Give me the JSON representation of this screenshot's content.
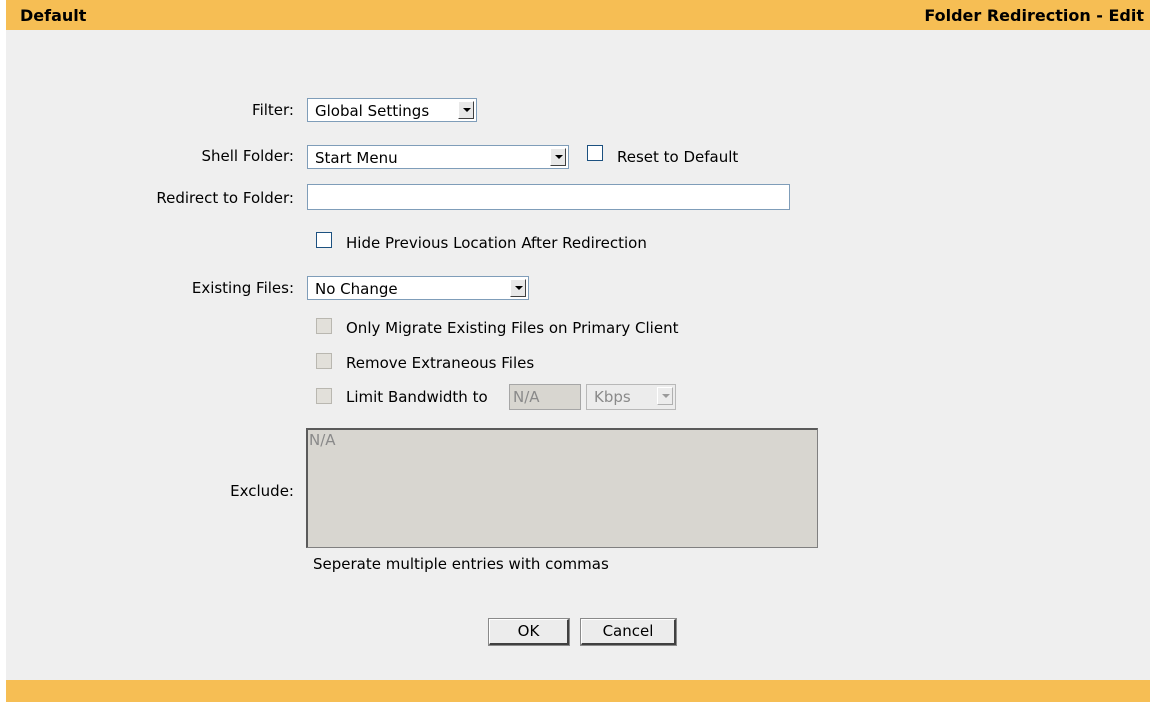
{
  "header": {
    "left_title": "Default",
    "right_title": "Folder Redirection - Edit"
  },
  "form": {
    "filter": {
      "label": "Filter:",
      "value": "Global Settings"
    },
    "shell_folder": {
      "label": "Shell Folder:",
      "value": "Start Menu",
      "reset_label": "Reset to Default",
      "reset_checked": false
    },
    "redirect": {
      "label": "Redirect to Folder:",
      "value": ""
    },
    "hide_previous": {
      "label": "Hide Previous Location After Redirection",
      "checked": false
    },
    "existing_files": {
      "label": "Existing Files:",
      "value": "No Change"
    },
    "only_migrate": {
      "label": "Only Migrate Existing Files on Primary Client",
      "checked": false,
      "disabled": true
    },
    "remove_extraneous": {
      "label": "Remove Extraneous Files",
      "checked": false,
      "disabled": true
    },
    "limit_bandwidth": {
      "label": "Limit Bandwidth to",
      "value": "N/A",
      "unit": "Kbps",
      "checked": false,
      "disabled": true
    },
    "exclude": {
      "label": "Exclude:",
      "value": "N/A",
      "hint": "Seperate multiple entries with commas"
    }
  },
  "buttons": {
    "ok": "OK",
    "cancel": "Cancel"
  },
  "colors": {
    "accent": "#f6be54",
    "panel": "#efefef"
  },
  "icons": {
    "dropdown": "chevron-down-icon"
  }
}
